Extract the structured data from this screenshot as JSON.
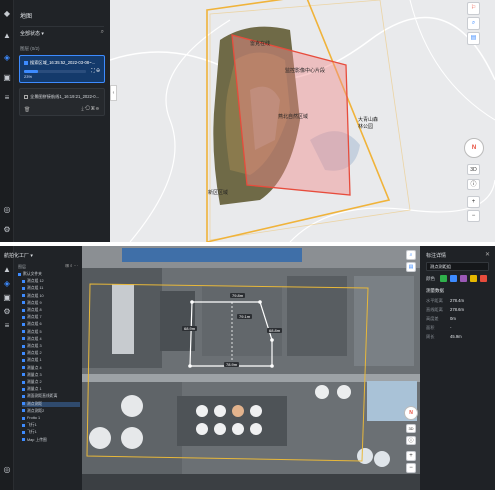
{
  "screen1": {
    "sidebar_title": "地图",
    "filter_label": "全部状态",
    "list_header": "图层 (0/2)",
    "item1": {
      "name": "搜索区域_16:35:52_2022-03-08~...",
      "progress": "23%"
    },
    "item2": {
      "name": "全景图拼接航线1_16:19:21_2022-0..."
    },
    "map_labels": {
      "label_a": "雷克在线",
      "label_b": "监控影像中心片段",
      "label_c": "燕北自然区域",
      "label_d": "大青山森林公园",
      "label_e": "新区区域"
    },
    "zoom_in": "+",
    "zoom_out": "−",
    "view_3d": "3D",
    "compass_n": "N"
  },
  "screen2": {
    "project_title": "航拍化工厂",
    "tree_header": "图层",
    "tree_items": [
      "默认文件夹",
      "测点组 12",
      "测点组 11",
      "测点组 10",
      "测点组 9",
      "测点组 8",
      "测点组 7",
      "测点组 6",
      "测点组 5",
      "测点组 4",
      "测点组 3",
      "测点组 2",
      "测点组 1",
      "测量点 4",
      "测量点 3",
      "测量点 2",
      "测量点 1",
      "测面测距直线距离",
      "测点测距",
      "测点测距2",
      "Frotto 1",
      "飞行1",
      "飞行1",
      "Map 上传图"
    ],
    "measurements": [
      "79.8m",
      "68.9m",
      "78.9m",
      "68.8m",
      "79.1m"
    ],
    "right_panel": {
      "title": "标注详情",
      "name_value": "测点测距组",
      "color_label": "颜色",
      "colors": [
        "#2fb14b",
        "#3d8bff",
        "#9b59b6",
        "#e6b800",
        "#e74c3c"
      ],
      "section": "测量数据",
      "rows": [
        {
          "k": "水平距离",
          "v": "278.4m"
        },
        {
          "k": "直线距离",
          "v": "278.6m"
        },
        {
          "k": "高度差",
          "v": "0m"
        },
        {
          "k": "面积",
          "v": "-"
        },
        {
          "k": "周长",
          "v": "45.9m"
        }
      ]
    },
    "zoom_in": "+",
    "zoom_out": "−",
    "view_3d": "3D",
    "compass_n": "N"
  }
}
